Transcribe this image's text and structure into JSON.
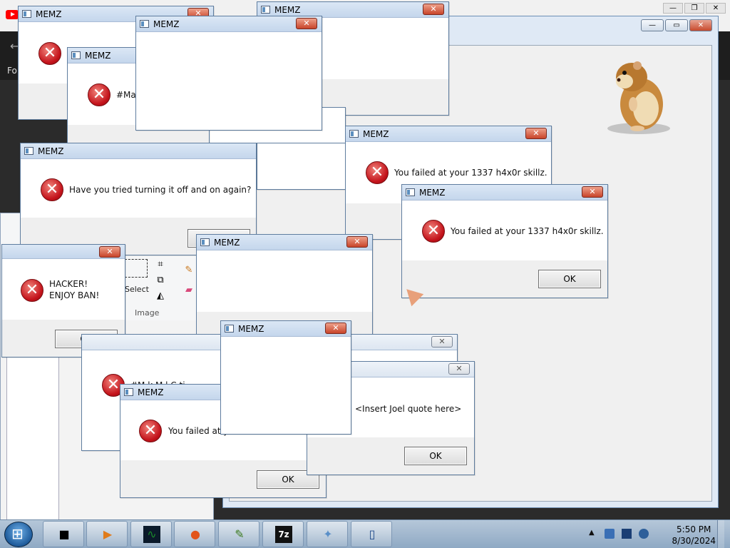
{
  "dialog_title": "MEMZ",
  "ok_label": "OK",
  "close_glyph": "✕",
  "icon_glyph": "✕",
  "messages": {
    "make": "#Mak",
    "make2": "#M k  M l  C  ti",
    "turn_off": "Have you tried turning it off and on again?",
    "failed": "You failed at your 1337 h4x0r skillz.",
    "failed_cut": "You failed at y",
    "hacker_line1": "HACKER!",
    "hacker_line2": "ENJOY BAN!",
    "joel": "<Insert Joel quote here>"
  },
  "browser": {
    "partial_label": "Fo"
  },
  "paint": {
    "select_label": "Select",
    "image_group_label": "Image"
  },
  "taskbar": {
    "time": "5:50 PM",
    "date": "8/30/2024",
    "apps": [
      {
        "name": "media-center",
        "glyph": "■"
      },
      {
        "name": "media-player",
        "glyph": "▶"
      },
      {
        "name": "task-manager",
        "glyph": "∿"
      },
      {
        "name": "firefox",
        "glyph": "●"
      },
      {
        "name": "notepad",
        "glyph": "✎"
      },
      {
        "name": "7zip",
        "glyph": "7z"
      },
      {
        "name": "paint",
        "glyph": "✦"
      },
      {
        "name": "tablet",
        "glyph": "▯"
      }
    ]
  },
  "colors": {
    "error_red": "#c4131b",
    "title_blue": "#c4d6ec",
    "taskbar": "#8fa9c4"
  }
}
